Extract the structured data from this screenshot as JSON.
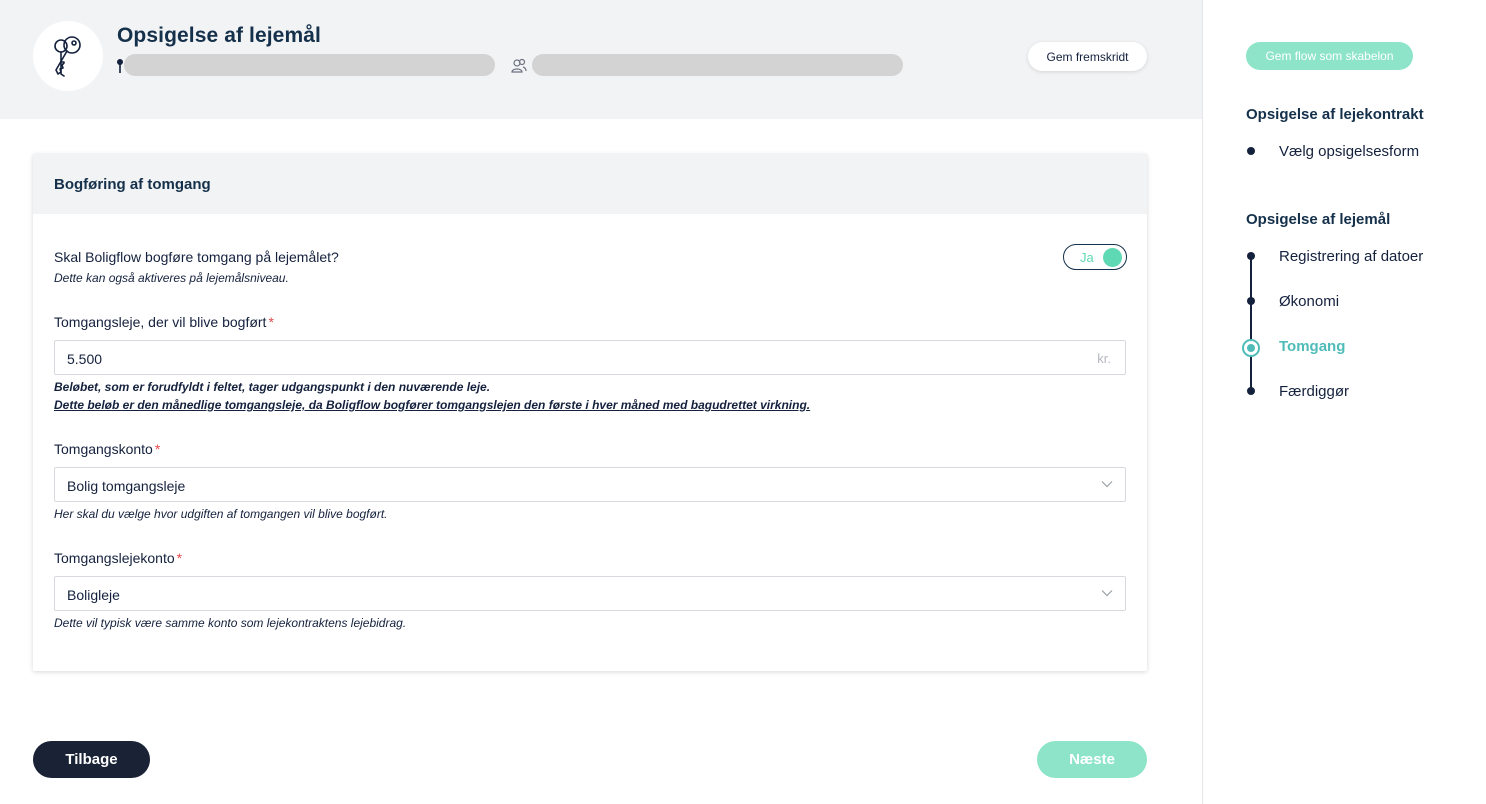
{
  "header": {
    "title": "Opsigelse af lejemål",
    "save_progress_label": "Gem fremskridt",
    "icons": {
      "avatar": "keys-icon",
      "address": "map-pin-icon",
      "tenants": "users-icon"
    }
  },
  "card": {
    "title": "Bogføring af tomgang",
    "toggle_question": "Skal Boligflow bogføre tomgang på lejemålet?",
    "toggle_hint": "Dette kan også aktiveres på lejemålsniveau.",
    "toggle_value": "Ja",
    "rent_label": "Tomgangsleje, der vil blive bogført",
    "required_mark": "*",
    "rent_value": "5.500",
    "rent_suffix": "kr.",
    "rent_hint_1": "Beløbet, som er forudfyldt i feltet, tager udgangspunkt i den nuværende leje.",
    "rent_hint_2": "Dette beløb er den månedlige tomgangsleje, da Boligflow bogfører tomgangslejen den første i hver måned med bagudrettet virkning.",
    "account_label": "Tomgangskonto",
    "account_value": "Bolig tomgangsleje",
    "account_hint": "Her skal du vælge hvor udgiften af tomgangen vil blive bogført.",
    "rent_account_label": "Tomgangslejekonto",
    "rent_account_value": "Boligleje",
    "rent_account_hint": "Dette vil typisk være samme konto som lejekontraktens lejebidrag."
  },
  "footer": {
    "back_label": "Tilbage",
    "next_label": "Næste"
  },
  "sidebar": {
    "save_template_label": "Gem flow som skabelon",
    "sections": [
      {
        "title": "Opsigelse af lejekontrakt",
        "steps": [
          "Vælg opsigelsesform"
        ]
      },
      {
        "title": "Opsigelse af lejemål",
        "steps": [
          "Registrering af datoer",
          "Økonomi",
          "Tomgang",
          "Færdiggør"
        ]
      }
    ],
    "active_step": "Tomgang"
  },
  "colors": {
    "accent": "#8ee4c9",
    "active_step": "#4fbcb8",
    "dark": "#1a2236",
    "required": "#e5484d"
  }
}
